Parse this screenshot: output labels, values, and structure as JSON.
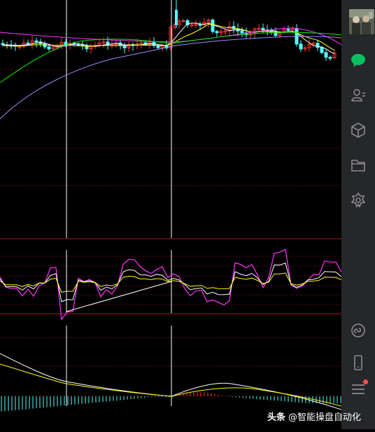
{
  "app": {
    "sidebar": {
      "items": [
        {
          "icon": "chat-icon",
          "active": true
        },
        {
          "icon": "contacts-icon",
          "active": false
        },
        {
          "icon": "box-icon",
          "active": false
        },
        {
          "icon": "folder-icon",
          "active": false
        },
        {
          "icon": "settings-icon",
          "active": false
        },
        {
          "icon": "miniprogram-icon",
          "active": false
        },
        {
          "icon": "phone-icon",
          "active": false
        },
        {
          "icon": "menu-icon",
          "active": false,
          "badge": true
        }
      ]
    },
    "colors": {
      "accent_green": "#07c160",
      "sidebar_bg": "#25272a",
      "icon_grey": "#8c8c8c",
      "candle_up": "#ff3333",
      "candle_down": "#54ffff",
      "ma_white": "#ffffff",
      "ma_yellow": "#ffff00",
      "ma_magenta": "#ff33ff",
      "ma_green": "#00e600",
      "ma_purple": "#9a8cff",
      "grid_red": "#8b1010"
    }
  },
  "watermark": {
    "brand": "头条",
    "handle": "@智能操盘自动化"
  }
}
